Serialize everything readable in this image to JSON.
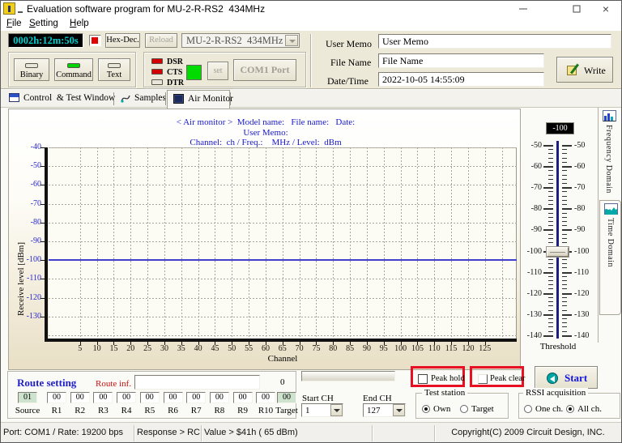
{
  "window": {
    "title": "Evaluation software program for MU-2-R-RS2  434MHz"
  },
  "menu": {
    "items": [
      "File",
      "Setting",
      "Help"
    ]
  },
  "toolbar": {
    "elapsed_time": "0002h:12m:50s",
    "hex_dec_button": "Hex-Dec.",
    "reload_button": "Reload",
    "model_combo_value": "MU-2-R-RS2  434MHz",
    "mode_buttons": [
      {
        "label": "Binary",
        "led": "off"
      },
      {
        "label": "Command",
        "led": "on"
      },
      {
        "label": "Text",
        "led": "off"
      }
    ],
    "signal_leds": [
      {
        "label": "DSR",
        "state": "on"
      },
      {
        "label": "CTS",
        "state": "on"
      },
      {
        "label": "DTR",
        "state": "off"
      }
    ],
    "set_button": "set",
    "com_port_button": "COM1 Port",
    "fields": {
      "user_memo_label": "User Memo",
      "user_memo_value": "User Memo",
      "file_name_label": "File Name",
      "file_name_value": "File Name",
      "date_time_label": "Date/Time",
      "date_time_value": "2022-10-05 14:55:09"
    },
    "write_button": "Write"
  },
  "tabs": {
    "items": [
      "Control  & Test Window",
      "Samples",
      "Air Monitor"
    ],
    "active": "Air Monitor"
  },
  "side_tabs": {
    "items": [
      "Frequency Domain",
      "Time Domain"
    ],
    "active": "Frequency Domain"
  },
  "chart": {
    "header_line1": "< Air monitor >  Model name:   File name:   Date:",
    "header_line2": "User Memo:",
    "header_line3": "Channel:  ch / Freq.:    MHz / Level:  dBm",
    "xlabel": "Channel",
    "ylabel": "Receive level [dBm]"
  },
  "chart_data": {
    "type": "line",
    "title": "< Air monitor >",
    "xlabel": "Channel",
    "ylabel": "Receive level [dBm]",
    "x_ticks": [
      5,
      10,
      15,
      20,
      25,
      30,
      35,
      40,
      45,
      50,
      55,
      60,
      65,
      70,
      75,
      80,
      85,
      90,
      95,
      100,
      105,
      110,
      115,
      120,
      125
    ],
    "y_ticks": [
      -40,
      -50,
      -60,
      -70,
      -80,
      -90,
      -100,
      -110,
      -120,
      -130
    ],
    "xlim": [
      1,
      130
    ],
    "ylim": [
      -143,
      -40
    ],
    "grid": "dashed",
    "series": [
      {
        "name": "Threshold level",
        "type": "hline",
        "y": -100,
        "color": "#4040cc",
        "note": "no RSSI data plotted"
      }
    ]
  },
  "threshold": {
    "readout": "-100",
    "value": -100,
    "label": "Threshold",
    "scale_labels": [
      -50,
      -60,
      -70,
      -80,
      -90,
      -100,
      -110,
      -120,
      -130,
      -140
    ]
  },
  "route": {
    "title": "Route setting",
    "inf_label": "Route inf.",
    "inf_value": "",
    "counter": "0",
    "boxes": [
      {
        "label": "Source",
        "value": "01",
        "highlight": true
      },
      {
        "label": "R1",
        "value": "00"
      },
      {
        "label": "R2",
        "value": "00"
      },
      {
        "label": "R3",
        "value": "00"
      },
      {
        "label": "R4",
        "value": "00"
      },
      {
        "label": "R5",
        "value": "00"
      },
      {
        "label": "R6",
        "value": "00"
      },
      {
        "label": "R7",
        "value": "00"
      },
      {
        "label": "R8",
        "value": "00"
      },
      {
        "label": "R9",
        "value": "00"
      },
      {
        "label": "R10",
        "value": "00"
      },
      {
        "label": "Target",
        "value": "00",
        "highlight": true
      }
    ]
  },
  "controls": {
    "peak_hold_label": "Peak hold",
    "peak_hold_checked": false,
    "peak_clear_label": "Peak clear",
    "peak_clear_checked": false,
    "start_button": "Start",
    "start_ch_label": "Start CH",
    "start_ch_value": "1",
    "end_ch_label": "End CH",
    "end_ch_value": "127",
    "test_station": {
      "title": "Test station",
      "options": [
        {
          "label": "Own",
          "selected": true
        },
        {
          "label": "Target",
          "selected": false
        }
      ]
    },
    "rssi_acquisition": {
      "title": "RSSI acquisition",
      "options": [
        {
          "label": "One ch.",
          "selected": false
        },
        {
          "label": "All ch.",
          "selected": true
        }
      ]
    }
  },
  "status_bar": {
    "panels": [
      "Port: COM1 / Rate: 19200 bps",
      "Response > RC",
      "Value > $41h ( 65 dBm)",
      "",
      "Copyright(C) 2009 Circuit Design, INC."
    ]
  },
  "colors": {
    "highlight_red": "#e81123",
    "led_green": "#00d400",
    "led_red": "#d40000",
    "led_off": "#e8e6da",
    "lcd_teal": "#00cdcd",
    "header_blue": "#1818cc",
    "threshold_line": "#4040cc"
  }
}
